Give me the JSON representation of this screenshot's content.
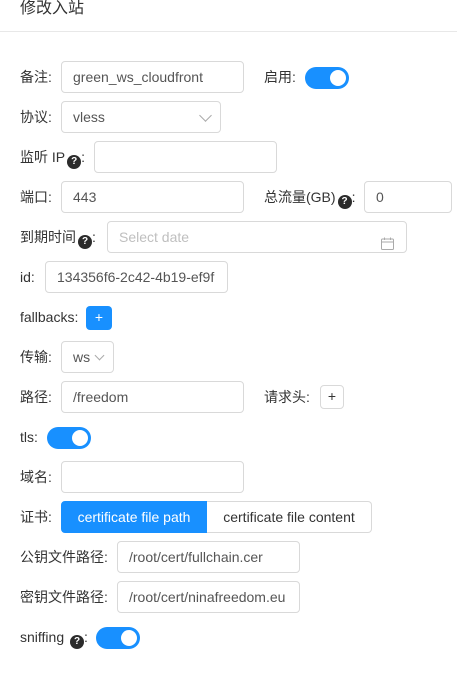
{
  "header": {
    "title": "修改入站"
  },
  "form": {
    "remark": {
      "label": "备注:",
      "value": "green_ws_cloudfront"
    },
    "enable": {
      "label": "启用:",
      "on": true
    },
    "protocol": {
      "label": "协议:",
      "value": "vless"
    },
    "listen_ip": {
      "label": "监听 IP",
      "value": ""
    },
    "port": {
      "label": "端口:",
      "value": "443"
    },
    "total_traffic": {
      "label": "总流量(GB)",
      "value": "0"
    },
    "expiry": {
      "label": "到期时间",
      "placeholder": "Select date"
    },
    "id": {
      "label": "id:",
      "value": "134356f6-2c42-4b19-ef9f"
    },
    "fallbacks": {
      "label": "fallbacks:",
      "add": "+"
    },
    "transport": {
      "label": "传输:",
      "value": "ws"
    },
    "path": {
      "label": "路径:",
      "value": "/freedom"
    },
    "request_header": {
      "label": "请求头:",
      "add": "+"
    },
    "tls": {
      "label": "tls:",
      "on": true
    },
    "domain": {
      "label": "域名:",
      "value": ""
    },
    "cert": {
      "label": "证书:",
      "options": [
        "certificate file path",
        "certificate file content"
      ],
      "selected": "certificate file path"
    },
    "public_key_path": {
      "label": "公钥文件路径:",
      "value": "/root/cert/fullchain.cer"
    },
    "private_key_path": {
      "label": "密钥文件路径:",
      "value": "/root/cert/ninafreedom.eu"
    },
    "sniffing": {
      "label": "sniffing",
      "on": true
    }
  },
  "colors": {
    "accent": "#1890ff",
    "border": "#d9d9d9",
    "text": "#333333"
  },
  "icons": [
    "question-icon",
    "calendar-icon",
    "chevron-down-icon",
    "plus-icon"
  ]
}
